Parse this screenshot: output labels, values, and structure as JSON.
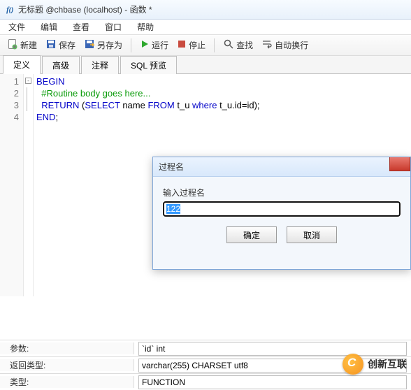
{
  "window": {
    "title": "无标题 @chbase (localhost) - 函数 *"
  },
  "menu": {
    "file": "文件",
    "edit": "编辑",
    "view": "查看",
    "window": "窗口",
    "help": "帮助"
  },
  "toolbar": {
    "new": "新建",
    "save": "保存",
    "saveas": "另存为",
    "run": "运行",
    "stop": "停止",
    "find": "查找",
    "wrap": "自动换行"
  },
  "tabs": {
    "definition": "定义",
    "advanced": "高级",
    "comment": "注释",
    "sqlpreview": "SQL 预览"
  },
  "code": {
    "lines": [
      "1",
      "2",
      "3",
      "4"
    ],
    "l1_kw": "BEGIN",
    "l2_cm": "#Routine body goes here...",
    "l3_kw1": "RETURN",
    "l3_p1": " (",
    "l3_kw2": "SELECT",
    "l3_p2": " name ",
    "l3_kw3": "FROM",
    "l3_p3": " t_u ",
    "l3_kw4": "where",
    "l3_p4": " t_u.id=id);",
    "l4_kw": "END",
    "l4_p": ";"
  },
  "dialog": {
    "title": "过程名",
    "label": "输入过程名",
    "value": "122",
    "ok": "确定",
    "cancel": "取消"
  },
  "props": {
    "params_label": "参数:",
    "params_value": "`id` int",
    "rettype_label": "返回类型:",
    "rettype_value": "varchar(255) CHARSET utf8",
    "ftype_label": "类型:",
    "ftype_value": "FUNCTION"
  },
  "watermark": {
    "text": "创新互联"
  }
}
